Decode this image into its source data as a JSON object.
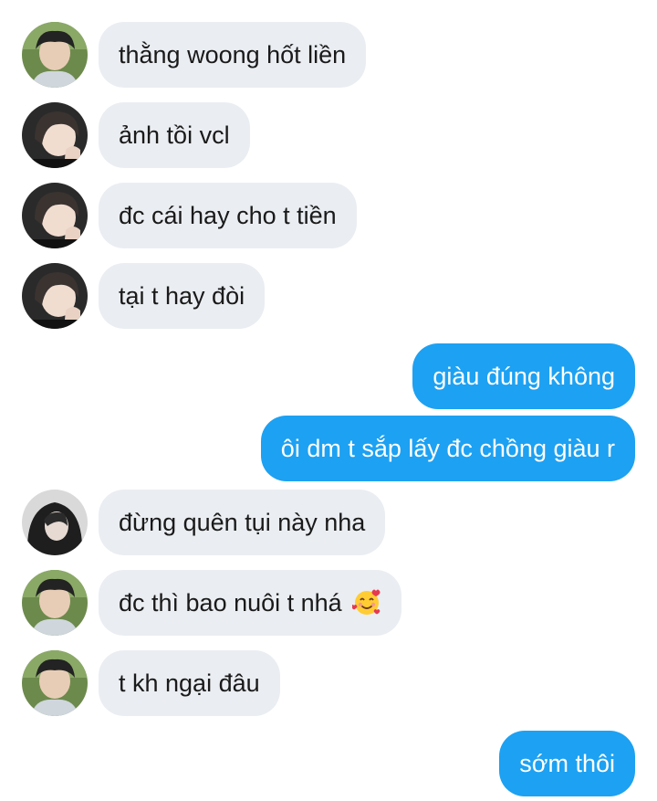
{
  "messages": [
    {
      "dir": "in",
      "text": "thằng woong hốt liền",
      "avatar": "avatar-boy"
    },
    {
      "dir": "in",
      "text": "ảnh tồi vcl",
      "avatar": "avatar-girl"
    },
    {
      "dir": "in",
      "text": "đc cái hay cho t tiền",
      "avatar": "avatar-girl"
    },
    {
      "dir": "in",
      "text": "tại t hay đòi",
      "avatar": "avatar-girl"
    },
    {
      "dir": "out",
      "text": "giàu đúng không"
    },
    {
      "dir": "out",
      "text": "ôi dm t sắp lấy đc chồng giàu r"
    },
    {
      "dir": "in",
      "text": "đừng quên tụi này nha",
      "avatar": "avatar-hood"
    },
    {
      "dir": "in",
      "text": "đc thì bao nuôi t nhá",
      "avatar": "avatar-boy",
      "emoji": "smiling-face-with-hearts-icon"
    },
    {
      "dir": "in",
      "text": "t kh ngại đâu",
      "avatar": "avatar-boy"
    },
    {
      "dir": "out",
      "text": "sớm thôi"
    }
  ],
  "colors": {
    "incoming_bubble": "#eaedf1",
    "outgoing_bubble": "#1da1f2",
    "incoming_text": "#1a1a1a",
    "outgoing_text": "#ffffff"
  }
}
